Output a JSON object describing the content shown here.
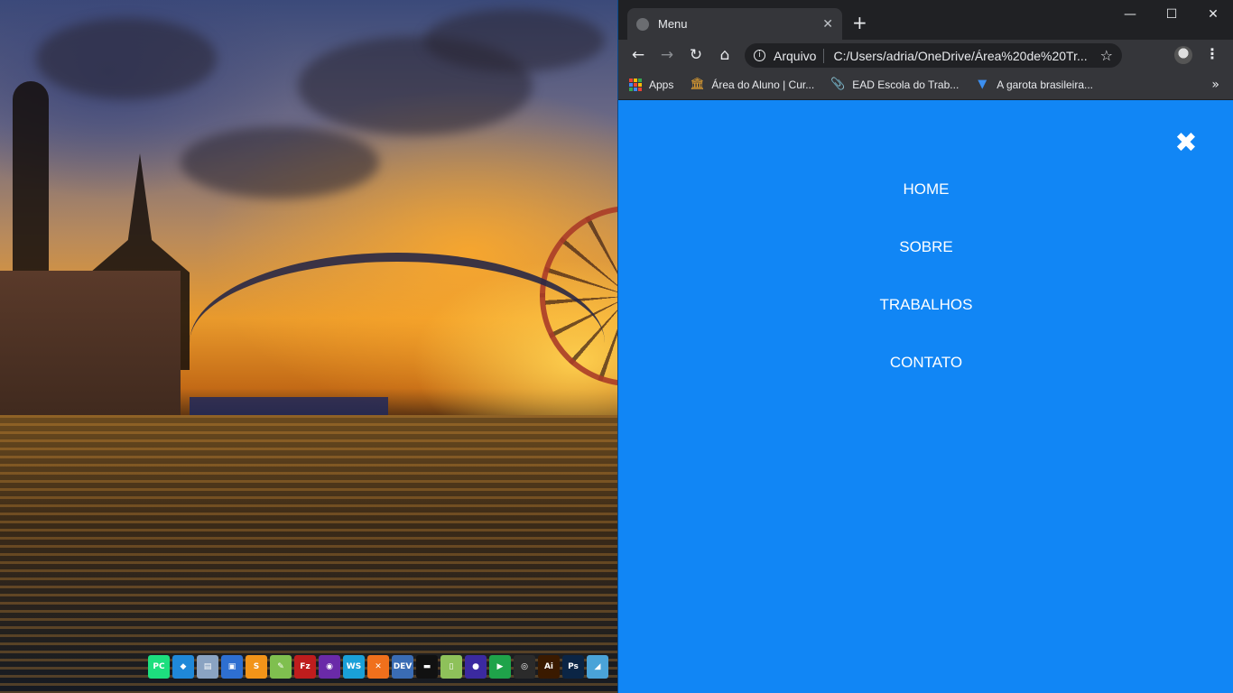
{
  "desktop": {
    "dock_icons": [
      {
        "name": "pycharm-icon",
        "glyph": "PC",
        "color": "#1ddf7e"
      },
      {
        "name": "vscode-icon",
        "glyph": "◆",
        "color": "#1f88d8"
      },
      {
        "name": "database-icon",
        "glyph": "▤",
        "color": "#8aa3c2"
      },
      {
        "name": "terminal-app-icon",
        "glyph": "▣",
        "color": "#2e6fd1"
      },
      {
        "name": "sublime-icon",
        "glyph": "S",
        "color": "#f29419"
      },
      {
        "name": "notepad-icon",
        "glyph": "✎",
        "color": "#7fbf4f"
      },
      {
        "name": "filezilla-icon",
        "glyph": "Fz",
        "color": "#bf1d1d"
      },
      {
        "name": "insomnia-icon",
        "glyph": "◉",
        "color": "#6a2aa8"
      },
      {
        "name": "webstorm-icon",
        "glyph": "WS",
        "color": "#1aa0d8"
      },
      {
        "name": "xampp-icon",
        "glyph": "✕",
        "color": "#f0701c"
      },
      {
        "name": "devcpp-icon",
        "glyph": "DEV",
        "color": "#3a6cb4"
      },
      {
        "name": "cmd-icon",
        "glyph": "▬",
        "color": "#111111"
      },
      {
        "name": "notes-icon",
        "glyph": "▯",
        "color": "#8ec15a"
      },
      {
        "name": "eclipse-icon",
        "glyph": "●",
        "color": "#3b2aa0"
      },
      {
        "name": "media-player-icon",
        "glyph": "▶",
        "color": "#1fa34a"
      },
      {
        "name": "obs-icon",
        "glyph": "◎",
        "color": "#2b2b2b"
      },
      {
        "name": "illustrator-icon",
        "glyph": "Ai",
        "color": "#3a1a00"
      },
      {
        "name": "photoshop-icon",
        "glyph": "Ps",
        "color": "#0b2545"
      },
      {
        "name": "extra-icon",
        "glyph": "◢",
        "color": "#4aa3d8"
      }
    ]
  },
  "browser": {
    "tab_title": "Menu",
    "tab_close": "✕",
    "new_tab": "+",
    "window_controls": {
      "minimize": "—",
      "maximize": "☐",
      "close": "✕"
    },
    "toolbar": {
      "back": "←",
      "forward": "→",
      "reload": "↻",
      "home": "⌂",
      "info": "i",
      "secure_label": "Arquivo",
      "url": "C:/Users/adria/OneDrive/Área%20de%20Tr...",
      "star": "☆",
      "menu": "⋮"
    },
    "bookmarks": [
      {
        "name": "bookmark-apps",
        "icon_name": "apps-icon",
        "label": "Apps"
      },
      {
        "name": "bookmark-area-do-aluno",
        "icon_name": "bank-icon",
        "glyph": "🏛",
        "icon_color": "#f0a830",
        "label": "Área do Aluno | Cur..."
      },
      {
        "name": "bookmark-ead",
        "icon_name": "paperclip-icon",
        "glyph": "📎",
        "icon_color": "#8ab4f8",
        "label": "EAD Escola do Trab..."
      },
      {
        "name": "bookmark-garota",
        "icon_name": "flag-icon",
        "glyph": "▼",
        "icon_color": "#3c8ff0",
        "label": "A garota brasileira..."
      }
    ],
    "bookmarks_more": "»"
  },
  "page": {
    "background": "#1186f5",
    "close_icon": "✖",
    "nav": [
      "HOME",
      "SOBRE",
      "TRABALHOS",
      "CONTATO"
    ]
  }
}
